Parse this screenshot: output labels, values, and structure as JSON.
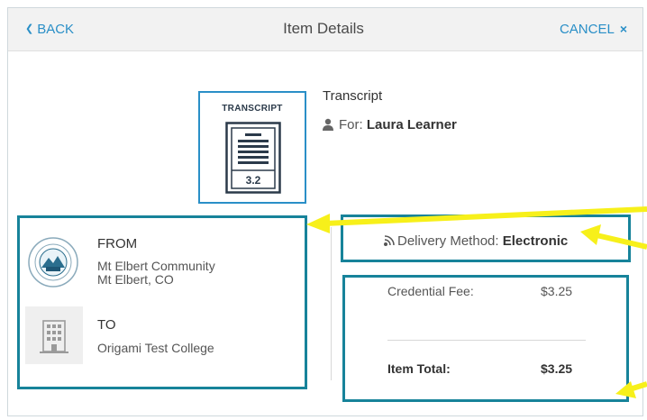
{
  "header": {
    "back_label": "BACK",
    "title": "Item Details",
    "cancel_label": "CANCEL"
  },
  "item": {
    "thumbnail_label": "TRANSCRIPT",
    "version_badge": "3.2",
    "name": "Transcript",
    "for_label": "For:",
    "for_name": "Laura Learner"
  },
  "from": {
    "label": "FROM",
    "institution": "Mt Elbert Community",
    "location": "Mt Elbert, CO"
  },
  "to": {
    "label": "TO",
    "institution": "Origami Test College"
  },
  "delivery": {
    "label": "Delivery Method:",
    "value": "Electronic"
  },
  "fees": {
    "credential_fee_label": "Credential Fee:",
    "credential_fee_value": "$3.25",
    "item_total_label": "Item Total:",
    "item_total_value": "$3.25"
  },
  "icons": {
    "back": "chevron-left-icon",
    "cancel": "close-icon",
    "person": "person-icon",
    "delivery": "wireless-signal-icon",
    "seal": "college-seal-icon",
    "building": "building-icon"
  },
  "colors": {
    "accent_blue": "#2a8fc7",
    "highlight_teal": "#17839a",
    "annotation_yellow": "#f7f01a"
  }
}
